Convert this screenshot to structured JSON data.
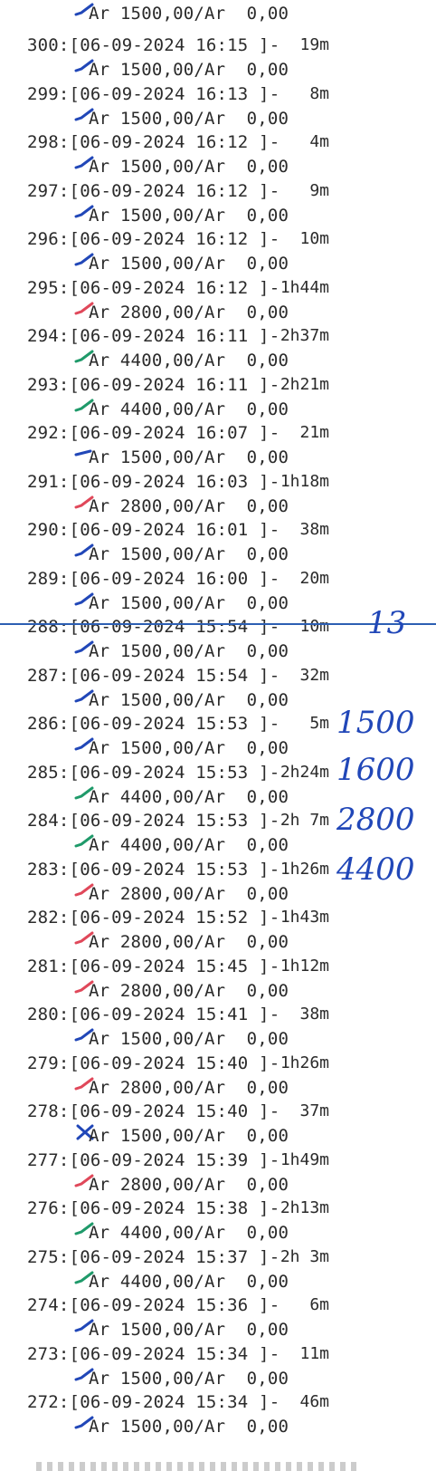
{
  "top": {
    "line2": "Ar 1500,00/Ar  0,00",
    "tick_color": "#2147b8",
    "tick": "check"
  },
  "rows": [
    {
      "id": "300",
      "date": "06-09-2024",
      "time": "16:15",
      "dur": "19m",
      "line2": "Ar 1500,00/Ar  0,00",
      "tick_color": "#2147b8",
      "tick": "check"
    },
    {
      "id": "299",
      "date": "06-09-2024",
      "time": "16:13",
      "dur": "8m",
      "line2": "Ar 1500,00/Ar  0,00",
      "tick_color": "#2147b8",
      "tick": "check"
    },
    {
      "id": "298",
      "date": "06-09-2024",
      "time": "16:12",
      "dur": "4m",
      "line2": "Ar 1500,00/Ar  0,00",
      "tick_color": "#2147b8",
      "tick": "check"
    },
    {
      "id": "297",
      "date": "06-09-2024",
      "time": "16:12",
      "dur": "9m",
      "line2": "Ar 1500,00/Ar  0,00",
      "tick_color": "#2147b8",
      "tick": "check"
    },
    {
      "id": "296",
      "date": "06-09-2024",
      "time": "16:12",
      "dur": "10m",
      "line2": "Ar 1500,00/Ar  0,00",
      "tick_color": "#2147b8",
      "tick": "check"
    },
    {
      "id": "295",
      "date": "06-09-2024",
      "time": "16:12",
      "dur": "1h44m",
      "line2": "Ar 2800,00/Ar  0,00",
      "tick_color": "#e0485a",
      "tick": "check"
    },
    {
      "id": "294",
      "date": "06-09-2024",
      "time": "16:11",
      "dur": "2h37m",
      "line2": "Ar 4400,00/Ar  0,00",
      "tick_color": "#1f9a6a",
      "tick": "check"
    },
    {
      "id": "293",
      "date": "06-09-2024",
      "time": "16:11",
      "dur": "2h21m",
      "line2": "Ar 4400,00/Ar  0,00",
      "tick_color": "#1f9a6a",
      "tick": "check"
    },
    {
      "id": "292",
      "date": "06-09-2024",
      "time": "16:07",
      "dur": "21m",
      "line2": "Ar 1500,00/Ar  0,00",
      "tick_color": "#2147b8",
      "tick": "dash"
    },
    {
      "id": "291",
      "date": "06-09-2024",
      "time": "16:03",
      "dur": "1h18m",
      "line2": "Ar 2800,00/Ar  0,00",
      "tick_color": "#e0485a",
      "tick": "check"
    },
    {
      "id": "290",
      "date": "06-09-2024",
      "time": "16:01",
      "dur": "38m",
      "line2": "Ar 1500,00/Ar  0,00",
      "tick_color": "#2147b8",
      "tick": "check"
    },
    {
      "id": "289",
      "date": "06-09-2024",
      "time": "16:00",
      "dur": "20m",
      "line2": "Ar 1500,00/Ar  0,00",
      "tick_color": "#2147b8",
      "tick": "check"
    },
    {
      "id": "288",
      "date": "06-09-2024",
      "time": "15:54",
      "dur": "10m",
      "line2": "Ar 1500,00/Ar  0,00",
      "tick_color": "#2147b8",
      "tick": "check"
    },
    {
      "id": "287",
      "date": "06-09-2024",
      "time": "15:54",
      "dur": "32m",
      "line2": "Ar 1500,00/Ar  0,00",
      "tick_color": "#2147b8",
      "tick": "check"
    },
    {
      "id": "286",
      "date": "06-09-2024",
      "time": "15:53",
      "dur": "5m",
      "line2": "Ar 1500,00/Ar  0,00",
      "tick_color": "#2147b8",
      "tick": "check"
    },
    {
      "id": "285",
      "date": "06-09-2024",
      "time": "15:53",
      "dur": "2h24m",
      "line2": "Ar 4400,00/Ar  0,00",
      "tick_color": "#1f9a6a",
      "tick": "check"
    },
    {
      "id": "284",
      "date": "06-09-2024",
      "time": "15:53",
      "dur": "2h 7m",
      "line2": "Ar 4400,00/Ar  0,00",
      "tick_color": "#1f9a6a",
      "tick": "check"
    },
    {
      "id": "283",
      "date": "06-09-2024",
      "time": "15:53",
      "dur": "1h26m",
      "line2": "Ar 2800,00/Ar  0,00",
      "tick_color": "#e0485a",
      "tick": "check"
    },
    {
      "id": "282",
      "date": "06-09-2024",
      "time": "15:52",
      "dur": "1h43m",
      "line2": "Ar 2800,00/Ar  0,00",
      "tick_color": "#e0485a",
      "tick": "check"
    },
    {
      "id": "281",
      "date": "06-09-2024",
      "time": "15:45",
      "dur": "1h12m",
      "line2": "Ar 2800,00/Ar  0,00",
      "tick_color": "#e0485a",
      "tick": "check"
    },
    {
      "id": "280",
      "date": "06-09-2024",
      "time": "15:41",
      "dur": "38m",
      "line2": "Ar 1500,00/Ar  0,00",
      "tick_color": "#2147b8",
      "tick": "check"
    },
    {
      "id": "279",
      "date": "06-09-2024",
      "time": "15:40",
      "dur": "1h26m",
      "line2": "Ar 2800,00/Ar  0,00",
      "tick_color": "#e0485a",
      "tick": "check"
    },
    {
      "id": "278",
      "date": "06-09-2024",
      "time": "15:40",
      "dur": "37m",
      "line2": "Ar 1500,00/Ar  0,00",
      "tick_color": "#2147b8",
      "tick": "cross"
    },
    {
      "id": "277",
      "date": "06-09-2024",
      "time": "15:39",
      "dur": "1h49m",
      "line2": "Ar 2800,00/Ar  0,00",
      "tick_color": "#e0485a",
      "tick": "check"
    },
    {
      "id": "276",
      "date": "06-09-2024",
      "time": "15:38",
      "dur": "2h13m",
      "line2": "Ar 4400,00/Ar  0,00",
      "tick_color": "#1f9a6a",
      "tick": "check"
    },
    {
      "id": "275",
      "date": "06-09-2024",
      "time": "15:37",
      "dur": "2h 3m",
      "line2": "Ar 4400,00/Ar  0,00",
      "tick_color": "#1f9a6a",
      "tick": "check"
    },
    {
      "id": "274",
      "date": "06-09-2024",
      "time": "15:36",
      "dur": "6m",
      "line2": "Ar 1500,00/Ar  0,00",
      "tick_color": "#2147b8",
      "tick": "check"
    },
    {
      "id": "273",
      "date": "06-09-2024",
      "time": "15:34",
      "dur": "11m",
      "line2": "Ar 1500,00/Ar  0,00",
      "tick_color": "#2147b8",
      "tick": "check"
    },
    {
      "id": "272",
      "date": "06-09-2024",
      "time": "15:34",
      "dur": "46m",
      "line2": "Ar 1500,00/Ar  0,00",
      "tick_color": "#2147b8",
      "tick": "check"
    }
  ],
  "handwritten": [
    "13",
    "1500",
    "1600",
    "2800",
    "4400"
  ],
  "colors": {
    "ink": "#2b2b2b",
    "handwriting": "#2147b8",
    "divider": "#2d5fb3"
  }
}
